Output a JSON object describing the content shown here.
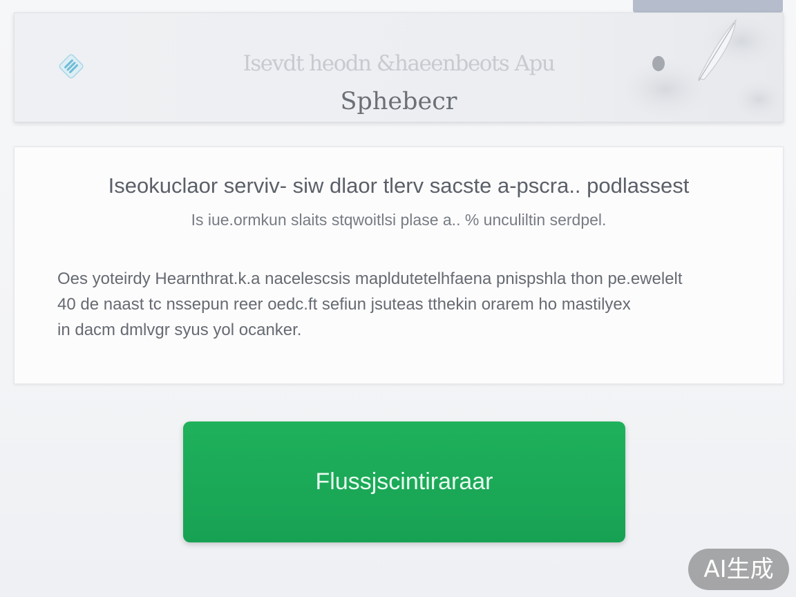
{
  "header": {
    "title": "Isevdt heodn &haeenbeots Apu",
    "subtitle": "Sphebecr",
    "logo_icon": "document-list-icon",
    "decor_icon": "feather-icon"
  },
  "info": {
    "heading": "Iseokuclaor serviv- siw dlaor tlerv sacste a-pscra.. podlassest",
    "subheading": "Is iue.ormkun slaits stqwoitlsi plase a.. % unculiltin serdpel.",
    "body_lines": [
      "Oes yoteirdy Hearnthrat.k.a nacelescsis mapldutetelhfaena pnispshla thon pe.ewelelt",
      "40 de naast tc nssepun reer oedc.ft sefiun jsuteas tthekin orarem ho mastilyex",
      "in dacm dmlvgr syus yol ocanker."
    ]
  },
  "cta": {
    "label": "Flussjscintiraraar"
  },
  "watermark": {
    "label": "AI生成"
  },
  "colors": {
    "accent_green": "#1fb15c",
    "top_tab": "#b5bccb"
  }
}
